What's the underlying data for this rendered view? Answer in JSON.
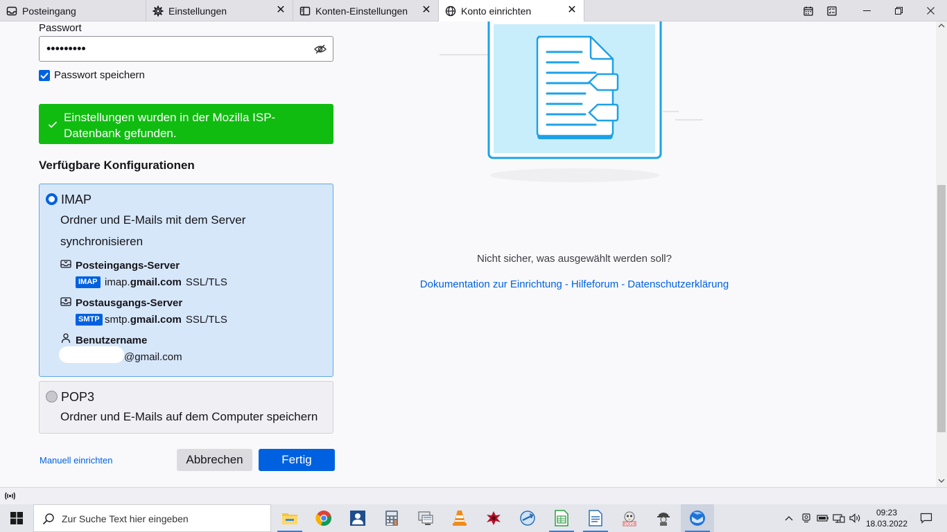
{
  "tabs": [
    {
      "label": "Posteingang",
      "icon": "inbox-icon"
    },
    {
      "label": "Einstellungen",
      "icon": "gear-icon"
    },
    {
      "label": "Konten-Einstellungen",
      "icon": "account-icon"
    },
    {
      "label": "Konto einrichten",
      "icon": "globe-icon"
    }
  ],
  "form": {
    "password_label": "Passwort",
    "password_value": "•••••••••",
    "save_password_label": "Passwort speichern",
    "save_password_checked": true
  },
  "success_message": "Einstellungen wurden in der Mozilla ISP-Datenbank gefunden.",
  "configs": {
    "title": "Verfügbare Konfigurationen",
    "imap": {
      "name": "IMAP",
      "desc_line1": "Ordner und E-Mails mit dem Server",
      "desc_line2": "synchronisieren",
      "incoming_title": "Posteingangs-Server",
      "incoming_badge": "IMAP",
      "incoming_host_prefix": "imap.",
      "incoming_host_domain": "gmail.com",
      "incoming_security": "SSL/TLS",
      "outgoing_title": "Postausgangs-Server",
      "outgoing_badge": "SMTP",
      "outgoing_host_prefix": "smtp.",
      "outgoing_host_domain": "gmail.com",
      "outgoing_security": "SSL/TLS",
      "username_title": "Benutzername",
      "username_value": "@gmail.com"
    },
    "pop3": {
      "name": "POP3",
      "desc": "Ordner und E-Mails auf dem Computer speichern"
    }
  },
  "actions": {
    "manual": "Manuell einrichten",
    "cancel": "Abbrechen",
    "done": "Fertig"
  },
  "help": {
    "unsure": "Nicht sicher, was ausgewählt werden soll?",
    "link_docs": "Dokumentation zur Einrichtung",
    "link_forum": "Hilfeforum",
    "link_privacy": "Datenschutzerklärung",
    "separator": "-"
  },
  "taskbar": {
    "search_placeholder": "Zur Suche Text hier eingeben",
    "time": "09:23",
    "date": "18.03.2022"
  },
  "colors": {
    "accent": "#0061e0",
    "success": "#10bc10",
    "imap_bg": "#d6e7f9"
  }
}
